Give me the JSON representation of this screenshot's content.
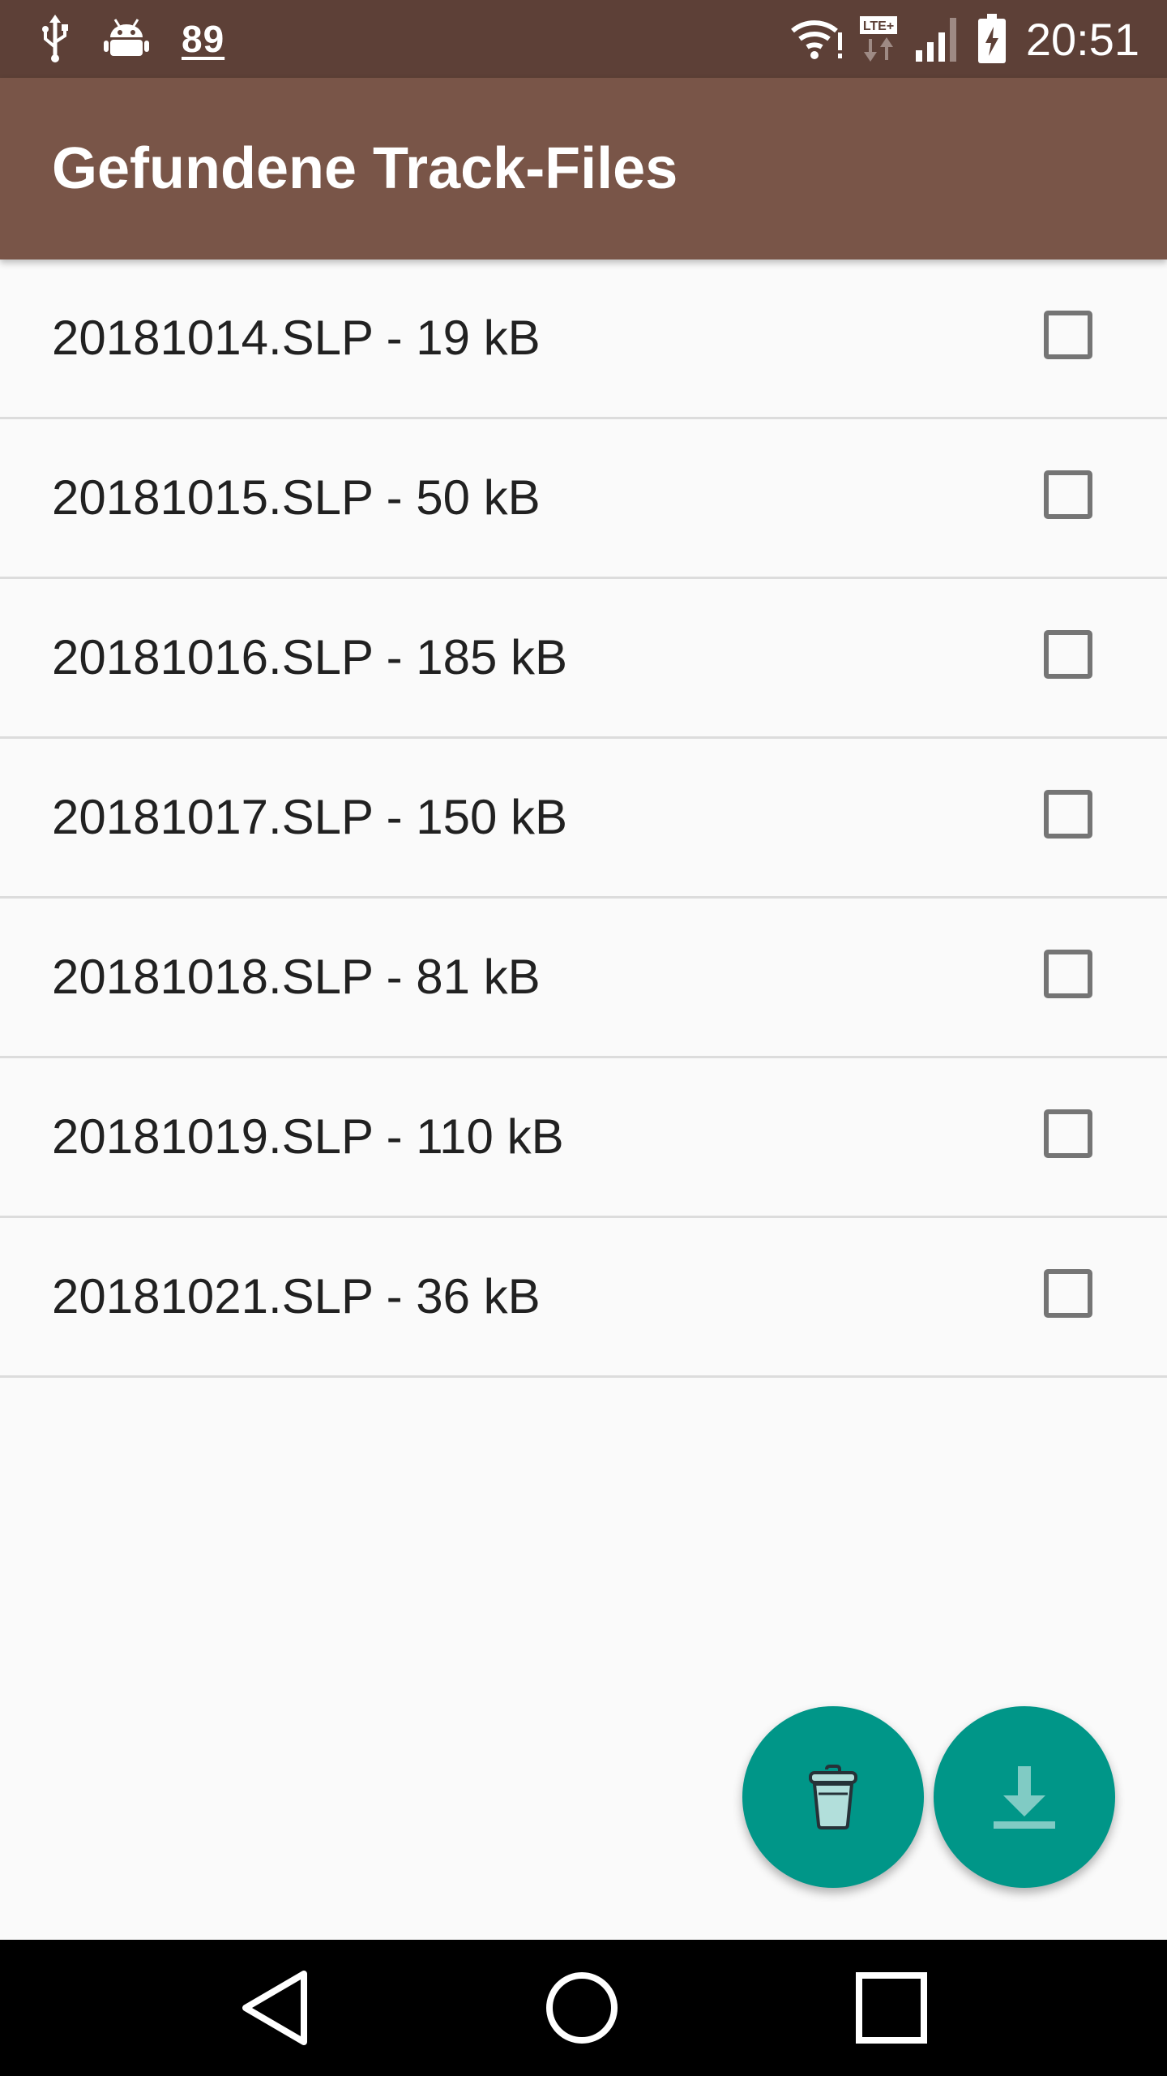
{
  "status_bar": {
    "notification_count": "89",
    "clock": "20:51",
    "left_icons": [
      "usb-icon",
      "android-debug-icon",
      "notification-count-badge"
    ],
    "right_icons": [
      "wifi-icon",
      "lte-data-icon",
      "cell-signal-icon",
      "battery-charging-icon"
    ]
  },
  "app_bar": {
    "title": "Gefundene Track-Files"
  },
  "files": [
    {
      "label": "20181014.SLP - 19 kB",
      "checked": false
    },
    {
      "label": "20181015.SLP - 50 kB",
      "checked": false
    },
    {
      "label": "20181016.SLP - 185 kB",
      "checked": false
    },
    {
      "label": "20181017.SLP - 150 kB",
      "checked": false
    },
    {
      "label": "20181018.SLP - 81 kB",
      "checked": false
    },
    {
      "label": "20181019.SLP - 110 kB",
      "checked": false
    },
    {
      "label": "20181021.SLP - 36 kB",
      "checked": false
    }
  ],
  "fabs": {
    "delete_icon": "trash-icon",
    "download_icon": "download-icon"
  },
  "nav_bar": {
    "buttons": [
      "back-icon",
      "home-icon",
      "recents-icon"
    ]
  },
  "colors": {
    "status_bar": "#5d4037",
    "app_bar": "#795548",
    "fab": "#009688",
    "background": "#fafafa"
  }
}
